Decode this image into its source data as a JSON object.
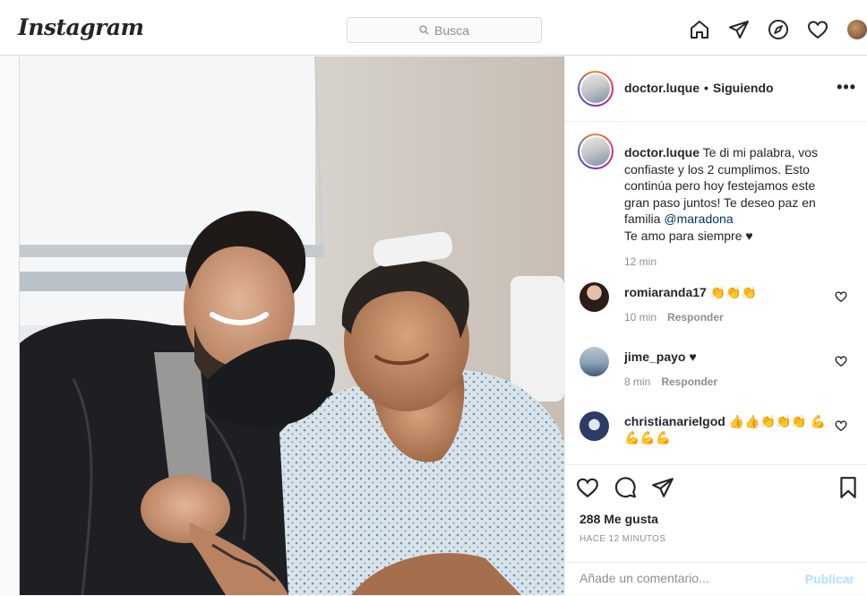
{
  "app": {
    "logo": "Instagram"
  },
  "search": {
    "placeholder_label": "Busca"
  },
  "nav": {
    "icons": [
      "home-icon",
      "direct-icon",
      "explore-icon",
      "activity-heart-icon",
      "profile-avatar"
    ]
  },
  "post": {
    "username": "doctor.luque",
    "dot": "•",
    "follow_status": "Siguiendo",
    "more": "•••",
    "caption": {
      "username": "doctor.luque",
      "line1": "Te di mi palabra, vos confiaste y los 2 cumplimos. Esto continúa pero hoy festejamos este gran paso juntos! Te deseo paz en familia",
      "mention": "@maradona",
      "line2": "Te amo para siempre ♥",
      "time": "12 min"
    },
    "comments": [
      {
        "user": "romiaranda17",
        "text": "👏👏👏",
        "time": "10 min",
        "reply": "Responder"
      },
      {
        "user": "jime_payo",
        "text": "♥",
        "time": "8 min",
        "reply": "Responder"
      },
      {
        "user": "christianarielgod",
        "text": "👍👍👏👏👏 💪💪💪💪"
      }
    ],
    "likes": "288 Me gusta",
    "posted_ago": "HACE 12 MINUTOS",
    "add_comment_placeholder": "Añade un comentario...",
    "publish_label": "Publicar"
  },
  "colors": {
    "link": "#00376b",
    "publish_disabled": "#b2dffc",
    "border": "#dbdbdb"
  }
}
